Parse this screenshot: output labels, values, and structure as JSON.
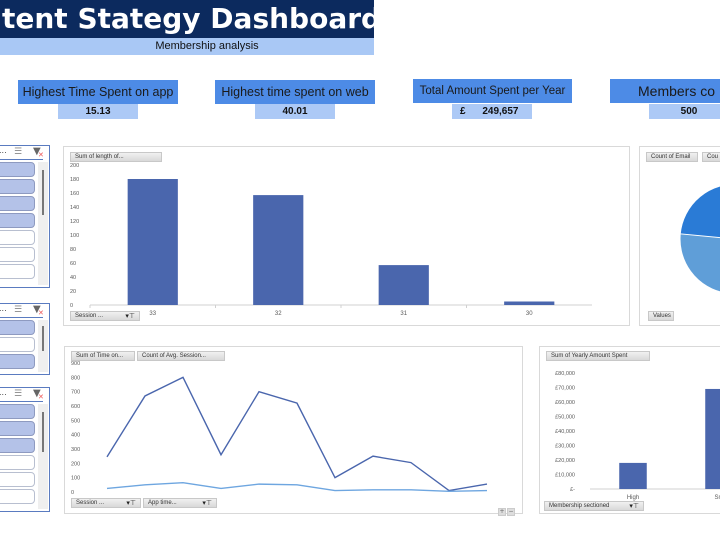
{
  "header": {
    "title": "tent Stategy Dashboard",
    "subtitle": "Membership analysis"
  },
  "kpis": [
    {
      "title": "Highest Time Spent on app",
      "value": "15.13"
    },
    {
      "title": "Highest time spent on web",
      "value": "40.01"
    },
    {
      "title": "Total Amount Spent per Year",
      "currency": "£",
      "value": "249,657"
    },
    {
      "title": "Members co",
      "value": "500"
    }
  ],
  "slicers": [
    {
      "header_text": "...",
      "items_selected": [
        true,
        true,
        true,
        true,
        false,
        false,
        false
      ]
    },
    {
      "header_text": "...",
      "items_selected": [
        true,
        false,
        true
      ]
    },
    {
      "header_text": "...",
      "items_selected": [
        true,
        true,
        true,
        false,
        false,
        false
      ]
    }
  ],
  "colors": {
    "title_bg": "#0c2a5e",
    "subtitle_bg": "#a9c8f5",
    "kpi_title_bg": "#4d8be6",
    "kpi_value_bg": "#acc9f6",
    "bar": "#4a66ad",
    "line_primary": "#4a66ad",
    "line_secondary": "#6ea6e0",
    "pie_dark": "#2a7bd6",
    "pie_light": "#5f9ed8"
  },
  "chart_data": [
    {
      "type": "bar",
      "field_button": "Sum of length of...",
      "axis_field_button": "Session ...",
      "categories": [
        "33",
        "32",
        "31",
        "30"
      ],
      "values": [
        180,
        157,
        57,
        5
      ],
      "yticks": [
        "0",
        "20",
        "40",
        "60",
        "80",
        "100",
        "120",
        "140",
        "160",
        "180",
        "200"
      ],
      "ylim": [
        0,
        200
      ],
      "grid": false
    },
    {
      "type": "pie",
      "field_buttons": [
        "Count of Email",
        "Cou"
      ],
      "legend_button": "Values",
      "slices": [
        {
          "name": "Count of Email",
          "value": 50
        },
        {
          "name": "Cou",
          "value": 50
        }
      ]
    },
    {
      "type": "line",
      "field_buttons": [
        "Sum of Time on...",
        "Count of Avg. Session..."
      ],
      "axis_field_buttons": [
        "Session ...",
        "App time..."
      ],
      "yticks": [
        "0",
        "100",
        "200",
        "300",
        "400",
        "500",
        "600",
        "700",
        "800",
        "900"
      ],
      "ylim": [
        0,
        900
      ],
      "series": [
        {
          "name": "Sum of Time on...",
          "values": [
            245,
            670,
            800,
            260,
            700,
            620,
            100,
            250,
            205,
            10,
            55
          ]
        },
        {
          "name": "Count of Avg. Session...",
          "values": [
            25,
            50,
            65,
            25,
            55,
            50,
            10,
            15,
            15,
            5,
            10
          ]
        }
      ],
      "zoom_buttons": [
        "+",
        "−"
      ]
    },
    {
      "type": "bar",
      "field_button": "Sum of Yearly Amount Spent",
      "axis_field_button": "Membership sectioned",
      "categories": [
        "High",
        "Sm"
      ],
      "values": [
        18000,
        69000
      ],
      "yticks": [
        "£-",
        "£10,000",
        "£20,000",
        "£30,000",
        "£40,000",
        "£50,000",
        "£60,000",
        "£70,000",
        "£80,000"
      ],
      "ylim": [
        0,
        80000
      ],
      "grid": false
    }
  ]
}
